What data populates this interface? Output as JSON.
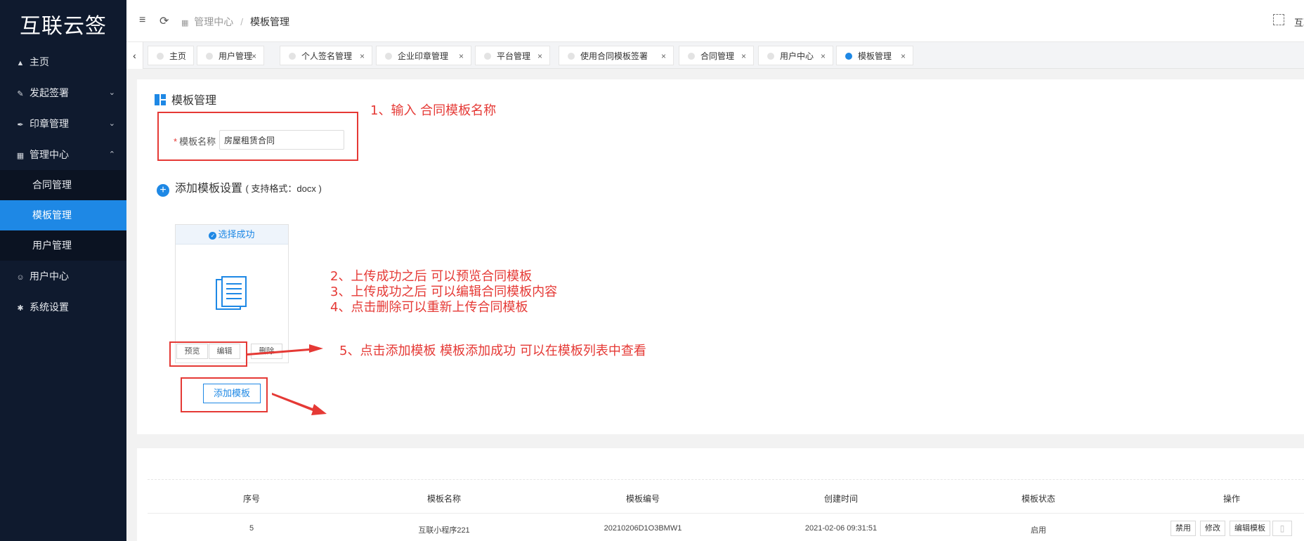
{
  "app": {
    "logo": "互联云签"
  },
  "sidebar": {
    "items": [
      {
        "label": "主页",
        "icon": "home-icon"
      },
      {
        "label": "发起签署",
        "icon": "sign-icon"
      },
      {
        "label": "印章管理",
        "icon": "pen-icon"
      },
      {
        "label": "管理中心",
        "icon": "grid-icon"
      },
      {
        "label": "用户中心",
        "icon": "user-icon"
      },
      {
        "label": "系统设置",
        "icon": "gear-icon"
      }
    ],
    "sub_items": [
      {
        "label": "合同管理"
      },
      {
        "label": "模板管理"
      },
      {
        "label": "用户管理"
      }
    ]
  },
  "header": {
    "breadcrumb_parent": "管理中心",
    "breadcrumb_sep": "/",
    "breadcrumb_current": "模板管理",
    "user_cut": "互联"
  },
  "tabs": [
    {
      "label": "主页"
    },
    {
      "label": "用户管理"
    },
    {
      "label": "个人签名管理"
    },
    {
      "label": "企业印章管理"
    },
    {
      "label": "平台管理"
    },
    {
      "label": "使用合同模板签署"
    },
    {
      "label": "合同管理"
    },
    {
      "label": "用户中心"
    },
    {
      "label": "模板管理"
    }
  ],
  "form": {
    "section_title": "模板管理",
    "required_mark": "*",
    "name_label": "模板名称",
    "name_value": "房屋租赁合同",
    "add_setting_label": "添加模板设置",
    "add_setting_hint": "( 支持格式：docx )",
    "upload_status": "选择成功",
    "preview_btn": "预览",
    "edit_btn": "编辑",
    "delete_btn": "删除",
    "add_template_btn": "添加模板"
  },
  "annotations": {
    "a1": "1、输入 合同模板名称",
    "a2": "2、上传成功之后 可以预览合同模板",
    "a3": "3、上传成功之后 可以编辑合同模板内容",
    "a4": "4、点击删除可以重新上传合同模板",
    "a5": "5、点击添加模板  模板添加成功 可以在模板列表中查看"
  },
  "table": {
    "headers": [
      "序号",
      "模板名称",
      "模板编号",
      "创建时间",
      "模板状态",
      "操作"
    ],
    "rows": [
      {
        "index": "5",
        "name": "互联小程序221",
        "code": "20210206D1O3BMW1",
        "created": "2021-02-06 09:31:51",
        "status": "启用",
        "actions": [
          "禁用",
          "修改",
          "编辑模板"
        ]
      }
    ]
  },
  "colors": {
    "accent": "#1e88e5",
    "annotation": "#e53935",
    "sidebar": "#0f1a2e"
  }
}
